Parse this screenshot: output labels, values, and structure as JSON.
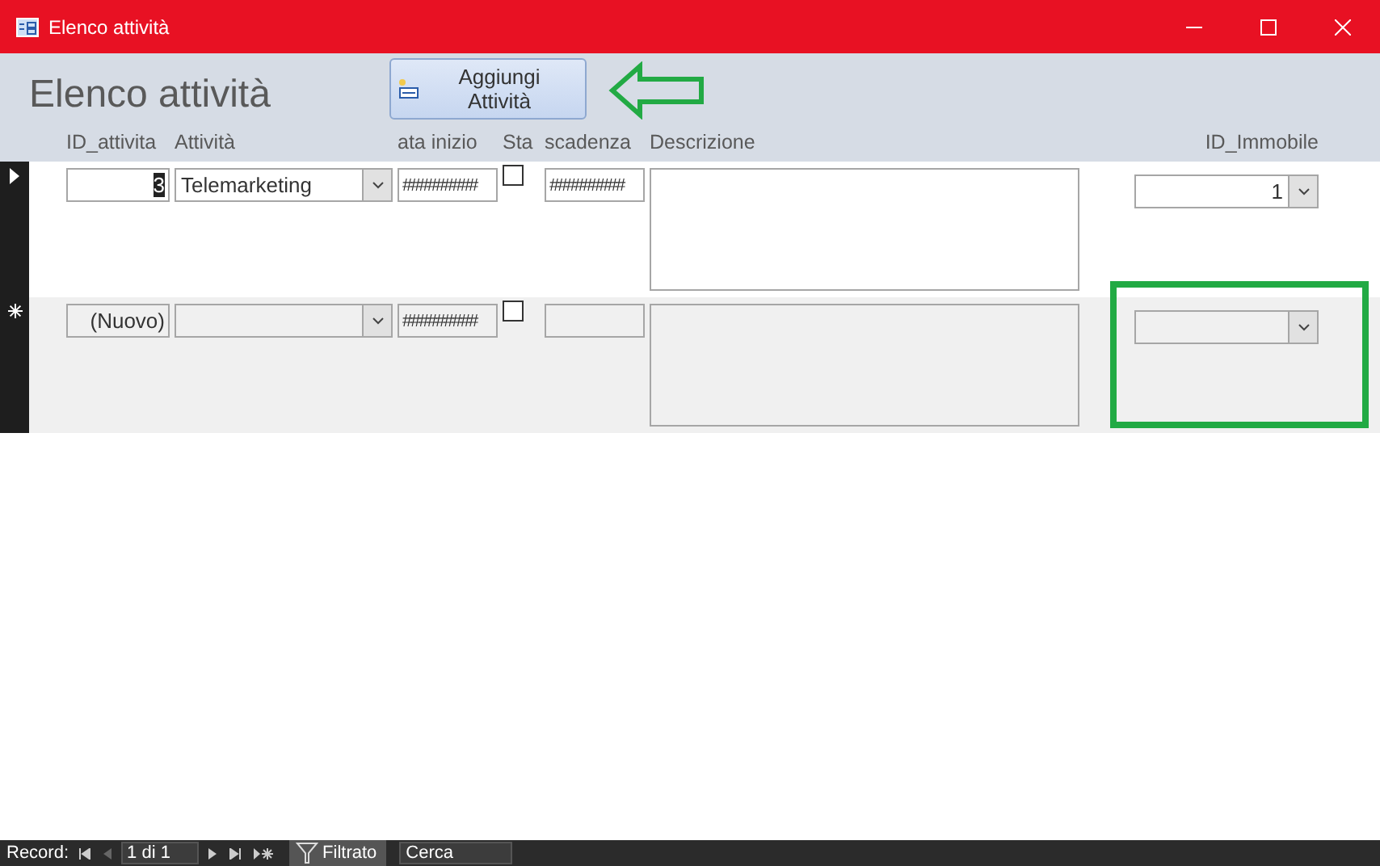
{
  "window": {
    "title": "Elenco attività"
  },
  "header": {
    "title": "Elenco attività",
    "add_button": "Aggiungi Attività"
  },
  "columns": [
    "ID_attivita",
    "Attività",
    "ata inizio",
    "Sta",
    "scadenza",
    "Descrizione",
    "ID_Immobile"
  ],
  "rows": [
    {
      "kind": "current",
      "id": "3",
      "attivita": "Telemarketing",
      "data_inizio": "#########",
      "checked": false,
      "scadenza": "#########",
      "id_immobile": "1",
      "highlighted": false
    },
    {
      "kind": "new",
      "id": "(Nuovo)",
      "data_inizio": "#########",
      "checked": false,
      "highlighted": true
    }
  ],
  "status_bar": {
    "label": "Record:",
    "position": "1 di 1",
    "filter": "Filtrato",
    "search": "Cerca"
  }
}
